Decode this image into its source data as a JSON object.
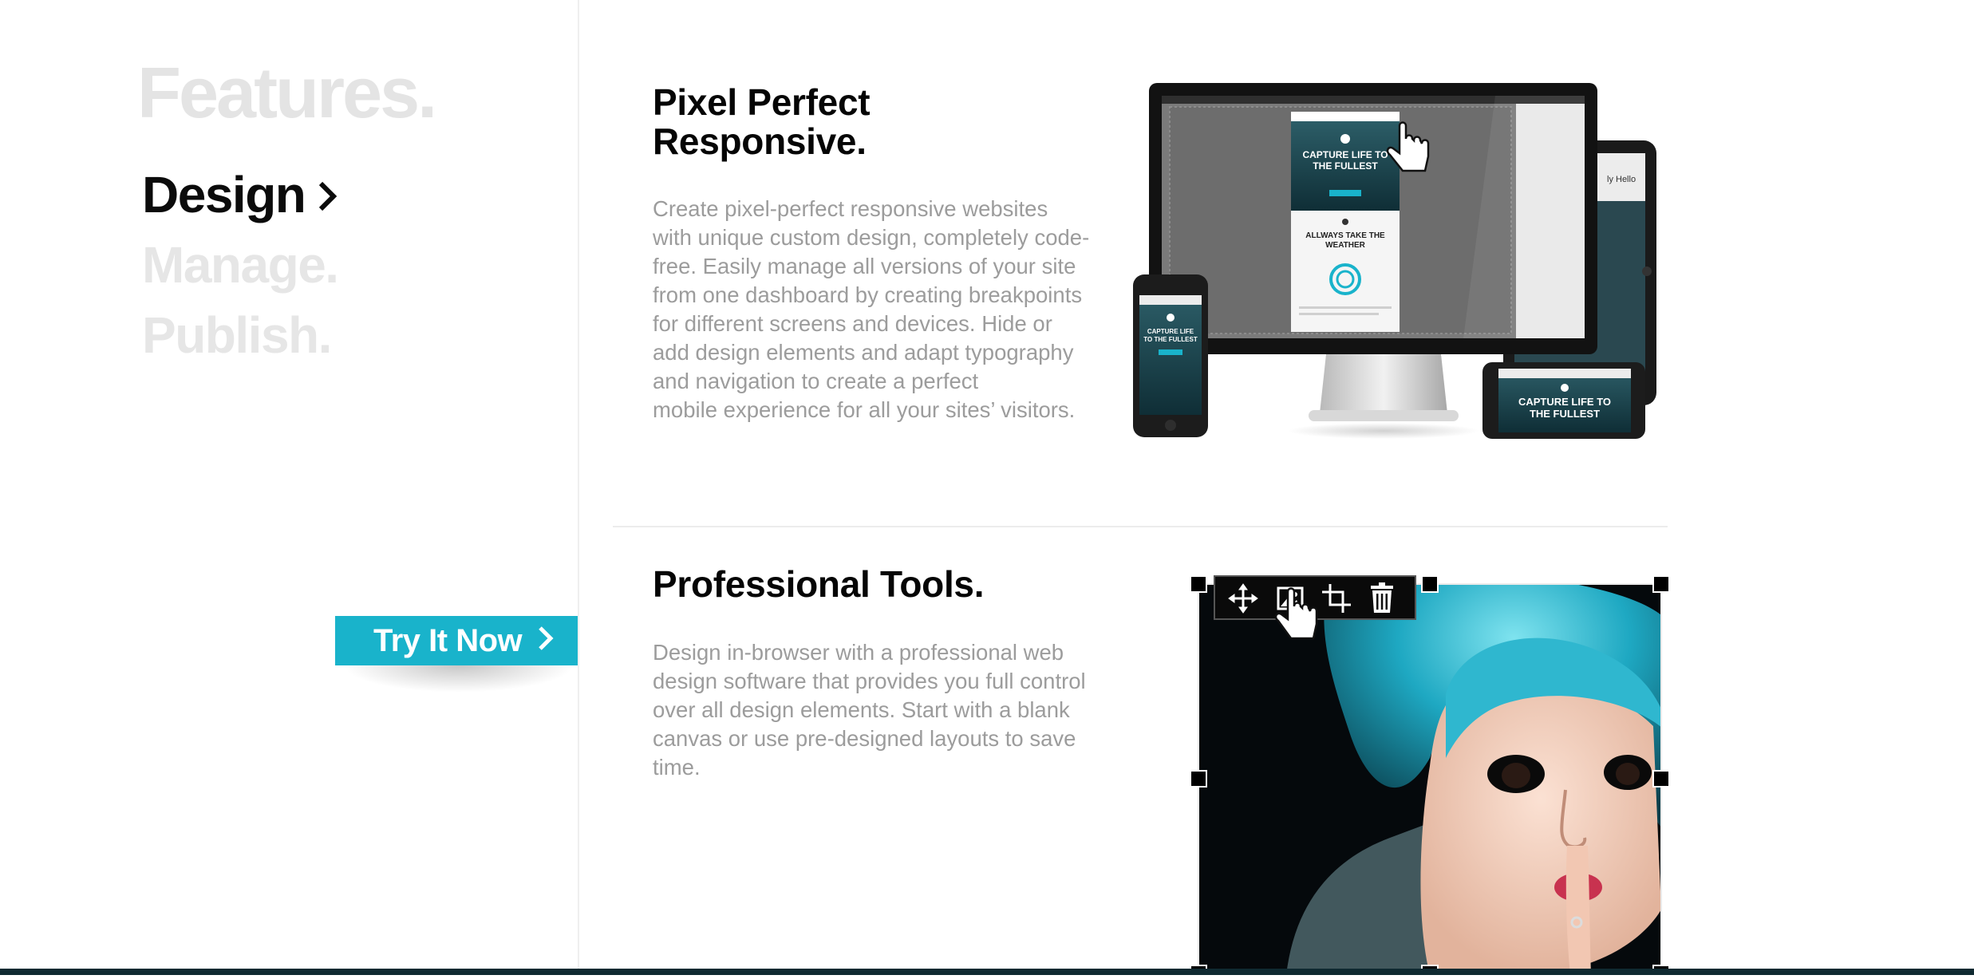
{
  "nav": {
    "heading": "Features.",
    "items": [
      {
        "label": "Design",
        "active": true
      },
      {
        "label": "Manage.",
        "active": false
      },
      {
        "label": "Publish.",
        "active": false
      }
    ]
  },
  "cta": {
    "label": "Try It Now"
  },
  "sections": [
    {
      "title_line1": "Pixel Perfect",
      "title_line2": "Responsive.",
      "body_lines": [
        "Create pixel-perfect responsive websites",
        "with unique custom design, completely code-",
        "free. Easily manage all versions of your site",
        "from one dashboard by creating breakpoints",
        "for different screens and devices. Hide or",
        "add design elements and adapt typography",
        "and navigation to create a perfect",
        "mobile experience for all your sites’ visitors."
      ]
    },
    {
      "title": "Professional Tools.",
      "body_lines": [
        "Design in-browser with a professional web",
        "design software that provides you full control",
        "over all design elements. Start with a blank",
        "canvas or use pre-designed layouts to save",
        "time."
      ]
    }
  ],
  "mockup": {
    "monitor_headline_1": "CAPTURE LIFE TO",
    "monitor_headline_2": "THE FULLEST",
    "monitor_sub_1": "ALLWAYS TAKE THE",
    "monitor_sub_2": "WEATHER",
    "monitor_side_1": "ly Hello",
    "phone_headline_1": "CAPTURE LIFE",
    "phone_headline_2": "TO THE FULLEST",
    "landscape_headline_1": "CAPTURE LIFE TO",
    "landscape_headline_2": "THE FULLEST"
  },
  "editor_toolbar": [
    "move-icon",
    "image-icon",
    "crop-icon",
    "trash-icon"
  ],
  "colors": {
    "accent": "#19b3cb",
    "nav_inactive": "#e6e6e6",
    "body_text": "#9c9c9c",
    "footer": "#0f2a31"
  }
}
